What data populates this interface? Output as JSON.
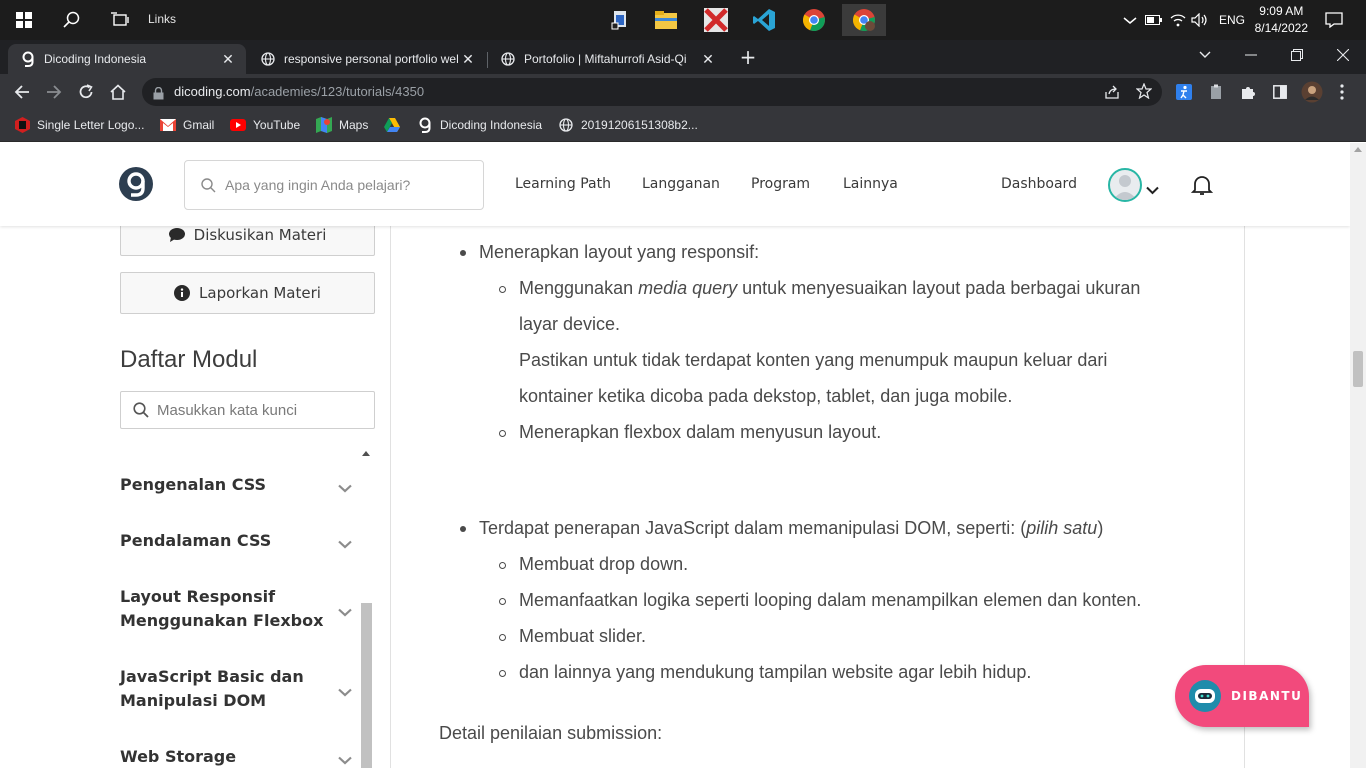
{
  "taskbar": {
    "links_label": "Links",
    "apps": [
      "file-explorer-pinned-icon",
      "file-explorer-icon",
      "xmind-icon",
      "vscode-icon",
      "chrome-icon",
      "chrome-profile-icon"
    ],
    "lang": "ENG",
    "time": "9:09 AM",
    "date": "8/14/2022"
  },
  "browser": {
    "tabs": [
      {
        "title": "Dicoding Indonesia",
        "active": true
      },
      {
        "title": "responsive personal portfolio wel",
        "active": false
      },
      {
        "title": "Portofolio | Miftahurrofi Asid-Qi",
        "active": false
      }
    ],
    "new_tab": "+",
    "url_host": "dicoding.com",
    "url_path": "/academies/123/tutorials/4350",
    "bookmarks": [
      "Single Letter Logo...",
      "Gmail",
      "YouTube",
      "Maps",
      "",
      "Dicoding Indonesia",
      "20191206151308b2..."
    ]
  },
  "site": {
    "search_placeholder": "Apa yang ingin Anda pelajari?",
    "nav": [
      "Learning Path",
      "Langganan",
      "Program",
      "Lainnya"
    ],
    "dashboard": "Dashboard"
  },
  "sidebar": {
    "discuss_label": "Diskusikan Materi",
    "report_label": "Laporkan Materi",
    "modules_title": "Daftar Modul",
    "module_search_placeholder": "Masukkan kata kunci",
    "modules": [
      {
        "line1": "Pengenalan CSS",
        "line2": ""
      },
      {
        "line1": "Pendalaman CSS",
        "line2": ""
      },
      {
        "line1": "Layout Responsif",
        "line2": "Menggunakan Flexbox"
      },
      {
        "line1": "JavaScript Basic dan",
        "line2": "Manipulasi DOM"
      },
      {
        "line1": "Web Storage",
        "line2": ""
      }
    ]
  },
  "content": {
    "b1": "Menerapkan layout yang responsif:",
    "b1_s1_pre": "Menggunakan ",
    "b1_s1_em": "media query",
    "b1_s1_post": " untuk menyesuaikan layout pada berbagai ukuran",
    "b1_s1_l2": "layar device.",
    "b1_s1_l3": "Pastikan untuk tidak terdapat konten yang menumpuk maupun keluar dari",
    "b1_s1_l4": "kontainer ketika dicoba pada dekstop, tablet, dan juga mobile.",
    "b1_s2": "Menerapkan flexbox dalam menyusun layout.",
    "b2_pre": "Terdapat penerapan JavaScript dalam memanipulasi DOM, seperti: (",
    "b2_em": "pilih satu",
    "b2_post": ")",
    "b2_items": [
      "Membuat drop down.",
      "Memanfaatkan logika seperti looping dalam menampilkan elemen dan konten.",
      "Membuat slider.",
      "dan lainnya yang mendukung tampilan website agar lebih hidup."
    ],
    "detail": "Detail penilaian submission:"
  },
  "chat": {
    "label": "DIBANTU",
    "color": "#f24a7c"
  }
}
